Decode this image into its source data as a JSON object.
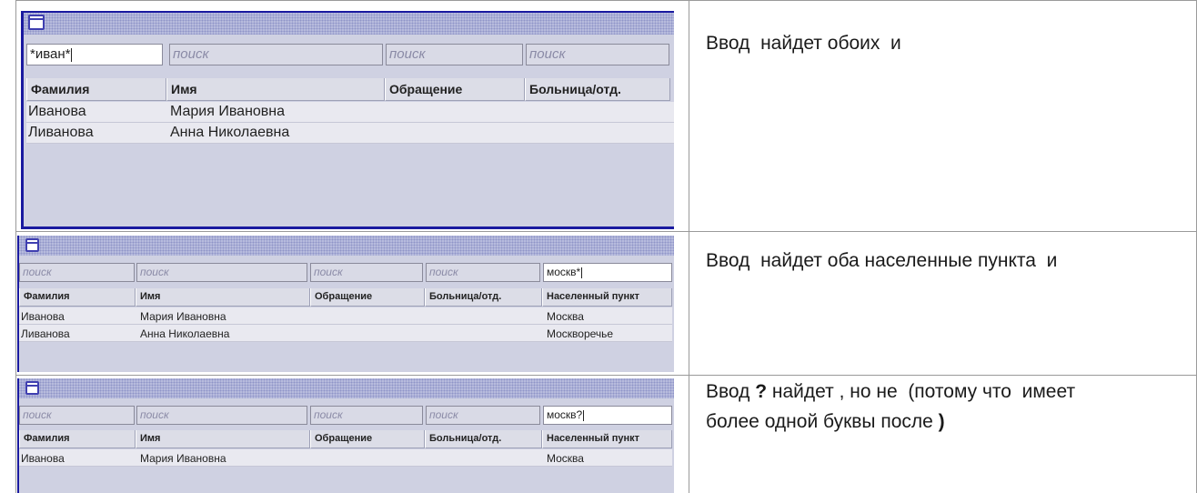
{
  "descriptions": [
    "Ввод  найдет обоих  и",
    "Ввод  найдет оба населенные пункта  и",
    "Ввод ? найдет , но не  (потому что  имеет\nболее одной буквы после )"
  ],
  "panel1": {
    "search": [
      "*иван*",
      "поиск",
      "поиск",
      "поиск"
    ],
    "columns": [
      "Фамилия",
      "Имя",
      "Обращение",
      "Больница/отд."
    ],
    "rows": [
      [
        "Иванова",
        "Мария Ивановна",
        "",
        ""
      ],
      [
        "Ливанова",
        "Анна Николаевна",
        "",
        ""
      ]
    ]
  },
  "panel2": {
    "search": [
      "поиск",
      "поиск",
      "поиск",
      "поиск",
      "москв*"
    ],
    "columns": [
      "Фамилия",
      "Имя",
      "Обращение",
      "Больница/отд.",
      "Населенный пункт"
    ],
    "rows": [
      [
        "Иванова",
        "Мария Ивановна",
        "",
        "",
        "Москва"
      ],
      [
        "Ливанова",
        "Анна Николаевна",
        "",
        "",
        "Москворечье"
      ]
    ]
  },
  "panel3": {
    "search": [
      "поиск",
      "поиск",
      "поиск",
      "поиск",
      "москв?"
    ],
    "columns": [
      "Фамилия",
      "Имя",
      "Обращение",
      "Больница/отд.",
      "Населенный пункт"
    ],
    "rows": [
      [
        "Иванова",
        "Мария Ивановна",
        "",
        "",
        "Москва"
      ]
    ]
  },
  "colors": {
    "accent": "#1a1aa0",
    "panel_bg": "#cfd1e2",
    "titlebar": "#b7bbdd"
  }
}
